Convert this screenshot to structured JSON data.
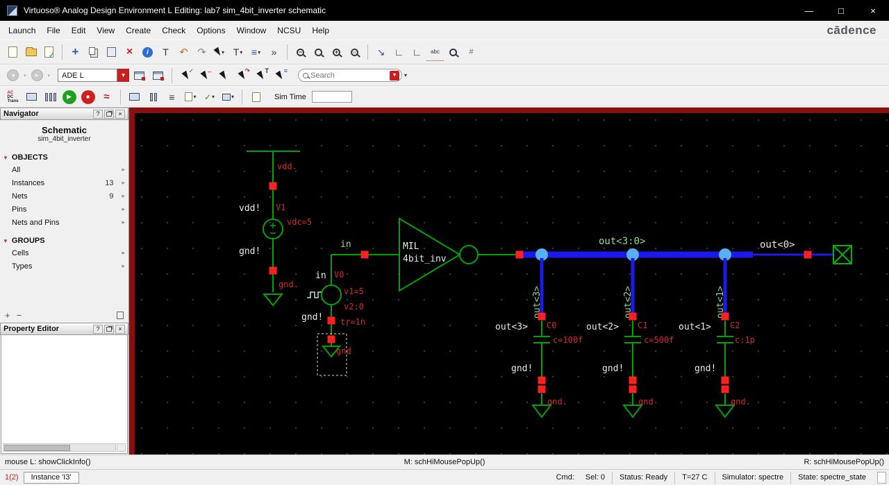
{
  "window": {
    "title": "Virtuoso® Analog Design Environment L Editing: lab7 sim_4bit_inverter schematic"
  },
  "glyphs": {
    "minimize": "—",
    "maximize": "□",
    "close": "×",
    "help": "?",
    "dropdown": "▾",
    "dropdown_solid": "▼",
    "check": "✓",
    "cross": "×",
    "info": "i",
    "undo": "↶",
    "redo": "↷",
    "chevrons": "»",
    "text_tool": "T",
    "align": "≡",
    "wire": "∟",
    "abc": "abc",
    "play": "▶",
    "stop": "■",
    "wave": "≈",
    "nav_back": "◄",
    "nav_fwd": "►",
    "plus": "+",
    "minus": "−",
    "descend": "↘",
    "arrow_item": "▸",
    "tri_open": "▼",
    "move": "+",
    "swap": "↔"
  },
  "menu": {
    "items": [
      "Launch",
      "File",
      "Edit",
      "View",
      "Create",
      "Check",
      "Options",
      "Window",
      "NCSU",
      "Help"
    ],
    "brand": "cādence"
  },
  "toolbar2": {
    "mode": "ADE L",
    "search_placeholder": "Search"
  },
  "toolbar3": {
    "analyses_lines": [
      "AC",
      "DC",
      "Trans"
    ],
    "sim_time_label": "Sim Time",
    "sim_time_value": ""
  },
  "navigator": {
    "title": "Navigator",
    "schematic_label": "Schematic",
    "cell_name": "sim_4bit_inverter",
    "objects_header": "OBJECTS",
    "objects": [
      {
        "label": "All",
        "count": ""
      },
      {
        "label": "Instances",
        "count": "13"
      },
      {
        "label": "Nets",
        "count": "9"
      },
      {
        "label": "Pins",
        "count": ""
      },
      {
        "label": "Nets and Pins",
        "count": ""
      }
    ],
    "groups_header": "GROUPS",
    "groups": [
      {
        "label": "Cells"
      },
      {
        "label": "Types"
      }
    ]
  },
  "property_editor": {
    "title": "Property Editor"
  },
  "schematic": {
    "v1": {
      "net": "vdd.",
      "supply_label": "vdd!",
      "name": "V1",
      "value": "vdc=5",
      "gnd_supply": "gnd!",
      "gnd_net": "gnd."
    },
    "v0": {
      "net": "in",
      "pin_label": "in",
      "name": "V0",
      "p1": "v1=5",
      "p2": "v2:0",
      "p3": "tr=1n",
      "gnd_supply": "gnd!",
      "gnd_net": "gnd"
    },
    "inverter": {
      "lib": "MIL",
      "cell": "4bit_inv"
    },
    "bus": {
      "name": "out<3:0>",
      "bit0": "out<0>"
    },
    "branches": [
      {
        "wire": "out<3>",
        "pin": "out<3>",
        "cap": "C0",
        "value": "c=100f",
        "gnd_supply": "gnd!",
        "gnd_net": "gnd."
      },
      {
        "wire": "out<2>",
        "pin": "out<2>",
        "cap": "C1",
        "value": "c=500f",
        "gnd_supply": "gnd!",
        "gnd_net": "gnd"
      },
      {
        "wire": "out<1>",
        "pin": "out<1>",
        "cap": "C2",
        "value": "c:1p",
        "gnd_supply": "gnd!",
        "gnd_net": "gnd."
      }
    ]
  },
  "status_mid": {
    "left": "mouse L: showClickInfo()",
    "center": "M: schHiMousePopUp()",
    "right": "R: schHiMousePopUp()"
  },
  "status_bar": {
    "badge": "1(2)",
    "instance": "Instance 'I3'",
    "cmd": "Cmd:",
    "sel": "Sel: 0",
    "status": "Status: Ready",
    "temp": "T=27 C",
    "simulator": "Simulator: spectre",
    "state": "State: spectre_state"
  }
}
